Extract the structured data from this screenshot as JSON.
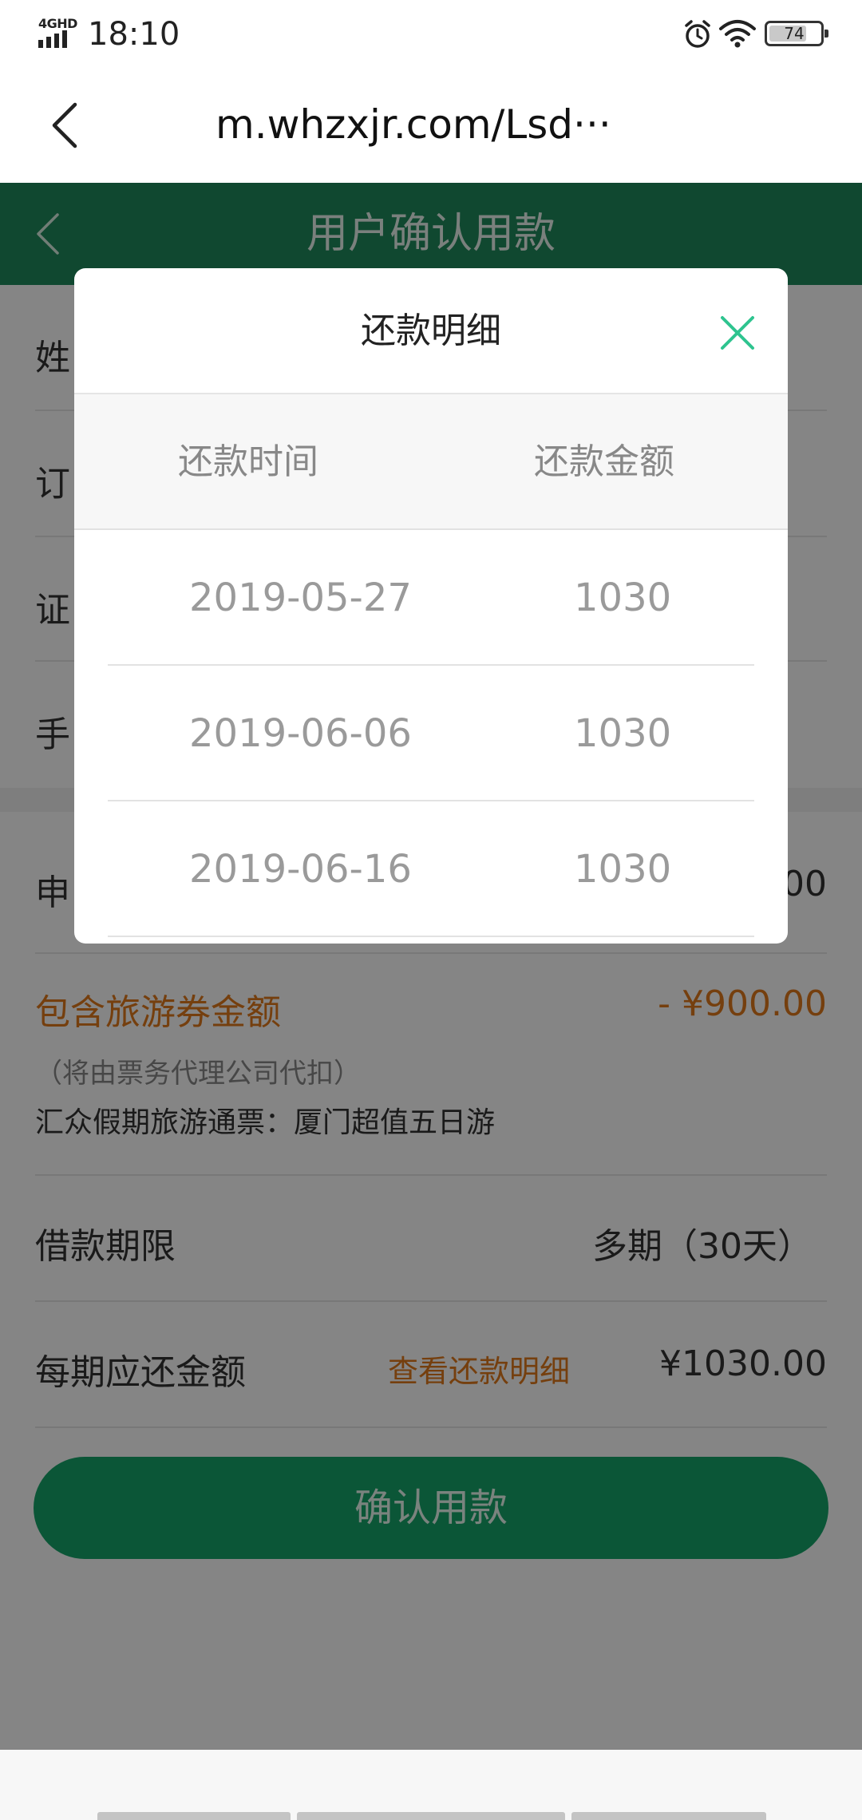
{
  "status_bar": {
    "network": "4GHD",
    "time": "18:10",
    "battery": "74",
    "battery_level": 0.74
  },
  "browser": {
    "url": "m.whzxjr.com/Lsd···"
  },
  "app_header": {
    "title": "用户确认用款"
  },
  "page": {
    "partial_labels": [
      "姓",
      "订",
      "证",
      "手",
      "申"
    ],
    "apply_amount_partial": "00",
    "voucher_label": "包含旅游券金额",
    "voucher_amount": "- ¥900.00",
    "voucher_note": "（将由票务代理公司代扣）",
    "voucher_product": "汇众假期旅游通票：厦门超值五日游",
    "term_label": "借款期限",
    "term_value": "多期（30天）",
    "installment_label": "每期应还金额",
    "view_detail_link": "查看还款明细",
    "installment_amount": "¥1030.00",
    "confirm_button": "确认用款"
  },
  "modal": {
    "title": "还款明细",
    "columns": [
      "还款时间",
      "还款金额"
    ],
    "rows": [
      {
        "date": "2019-05-27",
        "amount": "1030"
      },
      {
        "date": "2019-06-06",
        "amount": "1030"
      },
      {
        "date": "2019-06-16",
        "amount": "1030"
      }
    ]
  },
  "colors": {
    "brand_green": "#1f8a5d",
    "accent_orange": "#e07a1c",
    "close_teal": "#2ec48f"
  },
  "icons": [
    "signal-icon",
    "alarm-icon",
    "wifi-icon",
    "battery-icon",
    "back-icon",
    "close-icon"
  ]
}
